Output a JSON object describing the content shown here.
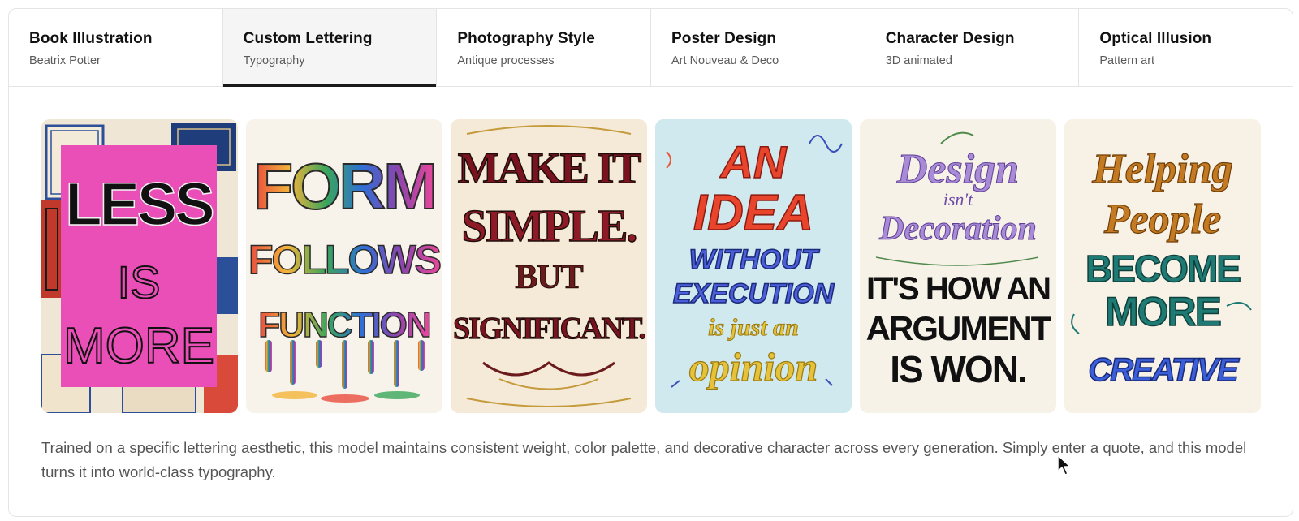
{
  "tabs": [
    {
      "title": "Book Illustration",
      "subtitle": "Beatrix Potter",
      "active": false
    },
    {
      "title": "Custom Lettering",
      "subtitle": "Typography",
      "active": true
    },
    {
      "title": "Photography Style",
      "subtitle": "Antique processes",
      "active": false
    },
    {
      "title": "Poster Design",
      "subtitle": "Art Nouveau & Deco",
      "active": false
    },
    {
      "title": "Character Design",
      "subtitle": "3D animated",
      "active": false
    },
    {
      "title": "Optical Illusion",
      "subtitle": "Pattern art",
      "active": false
    }
  ],
  "posters": [
    {
      "lines": [
        "LESS",
        "IS",
        "MORE"
      ]
    },
    {
      "lines": [
        "FORM",
        "FOLLOWS",
        "FUNCTION"
      ]
    },
    {
      "lines": [
        "MAKE IT",
        "SIMPLE.",
        "BUT",
        "SIGNIFICANT."
      ]
    },
    {
      "lines": [
        "AN",
        "IDEA",
        "WITHOUT",
        "EXECUTION",
        "is just an",
        "opinion"
      ]
    },
    {
      "lines": [
        "Design",
        "isn't",
        "Decoration",
        "IT'S HOW AN",
        "ARGUMENT",
        "IS WON."
      ]
    },
    {
      "lines": [
        "Helping",
        "People",
        "BECOME",
        "MORE",
        "CREATIVE"
      ]
    }
  ],
  "description": "Trained on a specific lettering aesthetic, this model maintains consistent weight, color palette, and decorative character across every generation. Simply enter a quote, and this model turns it into world-class typography.",
  "colors": {
    "active_indicator": "#1a1a1a",
    "border": "#e4e4e4",
    "text_primary": "#111111",
    "text_secondary": "#5a5a5a"
  }
}
